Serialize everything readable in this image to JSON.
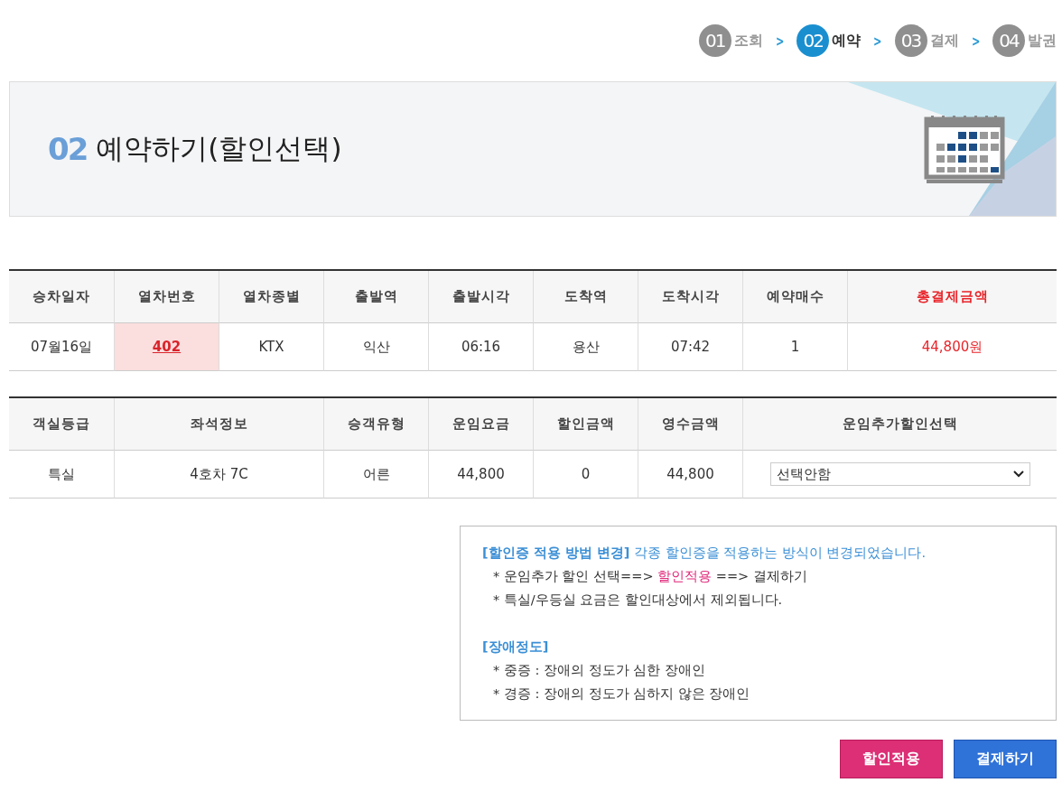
{
  "steps": [
    {
      "number": "01",
      "label": "조회",
      "selected": false
    },
    {
      "number": "02",
      "label": "예약",
      "selected": true
    },
    {
      "number": "03",
      "label": "결제",
      "selected": false
    },
    {
      "number": "04",
      "label": "발권",
      "selected": false
    }
  ],
  "step_separator": ">",
  "banner": {
    "number": "02",
    "title": "예약하기(할인선택)"
  },
  "train_table": {
    "columns": [
      {
        "label": "승차일자",
        "kind": "plain"
      },
      {
        "label": "열차번호",
        "kind": "plain"
      },
      {
        "label": "열차종별",
        "kind": "plain"
      },
      {
        "label": "출발역",
        "kind": "plain"
      },
      {
        "label": "출발시각",
        "kind": "plain"
      },
      {
        "label": "도착역",
        "kind": "plain"
      },
      {
        "label": "도착시각",
        "kind": "plain"
      },
      {
        "label": "예약매수",
        "kind": "plain"
      },
      {
        "label": "총결제금액",
        "kind": "total"
      }
    ],
    "rows": [
      [
        {
          "text": "07월16일",
          "kind": "plain"
        },
        {
          "text": "402",
          "kind": "link"
        },
        {
          "text": "KTX",
          "kind": "plain"
        },
        {
          "text": "익산",
          "kind": "plain"
        },
        {
          "text": "06:16",
          "kind": "plain"
        },
        {
          "text": "용산",
          "kind": "plain"
        },
        {
          "text": "07:42",
          "kind": "plain"
        },
        {
          "text": "1",
          "kind": "plain"
        },
        {
          "text": "44,800원",
          "kind": "total"
        }
      ]
    ]
  },
  "fare_table": {
    "columns": [
      {
        "label": "객실등급"
      },
      {
        "label": "좌석정보"
      },
      {
        "label": "승객유형"
      },
      {
        "label": "운임요금"
      },
      {
        "label": "할인금액"
      },
      {
        "label": "영수금액"
      },
      {
        "label": "운임추가할인선택"
      }
    ],
    "rows": [
      [
        {
          "text": "특실",
          "kind": "plain"
        },
        {
          "text": "4호차 7C",
          "kind": "plain"
        },
        {
          "text": "어른",
          "kind": "plain"
        },
        {
          "text": "44,800",
          "kind": "plain"
        },
        {
          "text": "0",
          "kind": "plain"
        },
        {
          "text": "44,800",
          "kind": "plain"
        },
        {
          "text": "선택안함",
          "kind": "select"
        }
      ]
    ]
  },
  "notice": [
    {
      "kind": "heading",
      "parts": [
        {
          "text": "**[할인증 적용 방법 변경]** 각종 할인증을 적용하는 방식이 변경되었습니다.",
          "highlight": false
        }
      ]
    },
    {
      "kind": "bullet",
      "parts": [
        {
          "text": "* 운임추가 할인 선택==> ",
          "highlight": false
        },
        {
          "text": "할인적용",
          "highlight": true
        },
        {
          "text": " ==> 결제하기",
          "highlight": false
        }
      ]
    },
    {
      "kind": "bullet",
      "parts": [
        {
          "text": "* 특실/우등실 요금은 할인대상에서 제외됩니다.",
          "highlight": false
        }
      ]
    },
    {
      "kind": "gap"
    },
    {
      "kind": "heading",
      "parts": [
        {
          "text": "**[장애정도]**",
          "highlight": false
        }
      ]
    },
    {
      "kind": "bullet",
      "parts": [
        {
          "text": "* 중증 : 장애의 정도가 심한 장애인",
          "highlight": false
        }
      ]
    },
    {
      "kind": "bullet",
      "parts": [
        {
          "text": "* 경증 : 장애의 정도가 심하지 않은 장애인",
          "highlight": false
        }
      ]
    }
  ],
  "buttons": [
    {
      "label": "할인적용",
      "kind": "discount"
    },
    {
      "label": "결제하기",
      "kind": "pay"
    }
  ]
}
